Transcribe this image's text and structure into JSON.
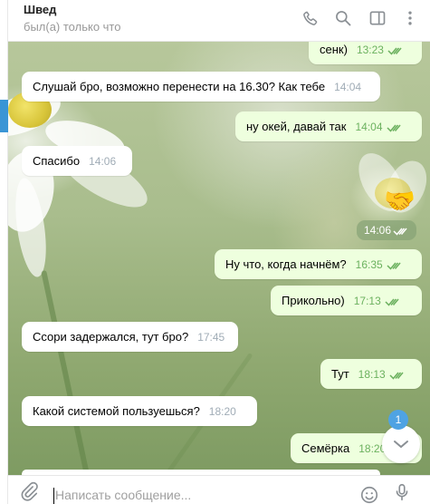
{
  "header": {
    "name": "Швед",
    "status": "был(а) только что",
    "icons": [
      "phone-icon",
      "search-icon",
      "sidebar-toggle-icon",
      "more-vertical-icon"
    ]
  },
  "messages": [
    {
      "dir": "out",
      "text": "сенк)",
      "time": "13:23",
      "read": true
    },
    {
      "dir": "in",
      "text": "Слушай бро, возможно перенести на 16.30? Как тебе",
      "time": "14:04"
    },
    {
      "dir": "out",
      "text": "ну окей, давай так",
      "time": "14:04",
      "read": true
    },
    {
      "dir": "in",
      "text": "Спасибо",
      "time": "14:06"
    },
    {
      "dir": "out",
      "sticker": "🤝",
      "time": "14:06",
      "read": true
    },
    {
      "dir": "out",
      "text": "Ну что, когда начнём?",
      "time": "16:35",
      "read": true
    },
    {
      "dir": "out",
      "text": "Прикольно)",
      "time": "17:13",
      "read": true
    },
    {
      "dir": "in",
      "text": "Ссори задержался, тут бро?",
      "time": "17:45"
    },
    {
      "dir": "out",
      "text": "Тут",
      "time": "18:13",
      "read": true
    },
    {
      "dir": "in",
      "text": "Какой системой пользуешься?",
      "time": "18:20"
    },
    {
      "dir": "out",
      "text": "Семёрка",
      "time": "18:20",
      "read": true
    }
  ],
  "scroll_down": {
    "unread_count": "1"
  },
  "composer": {
    "placeholder": "Написать сообщение..."
  },
  "colors": {
    "outgoing_bubble": "#eeffde",
    "incoming_bubble": "#ffffff",
    "check_green": "#6cb15f",
    "badge_blue": "#4fa3e3"
  }
}
